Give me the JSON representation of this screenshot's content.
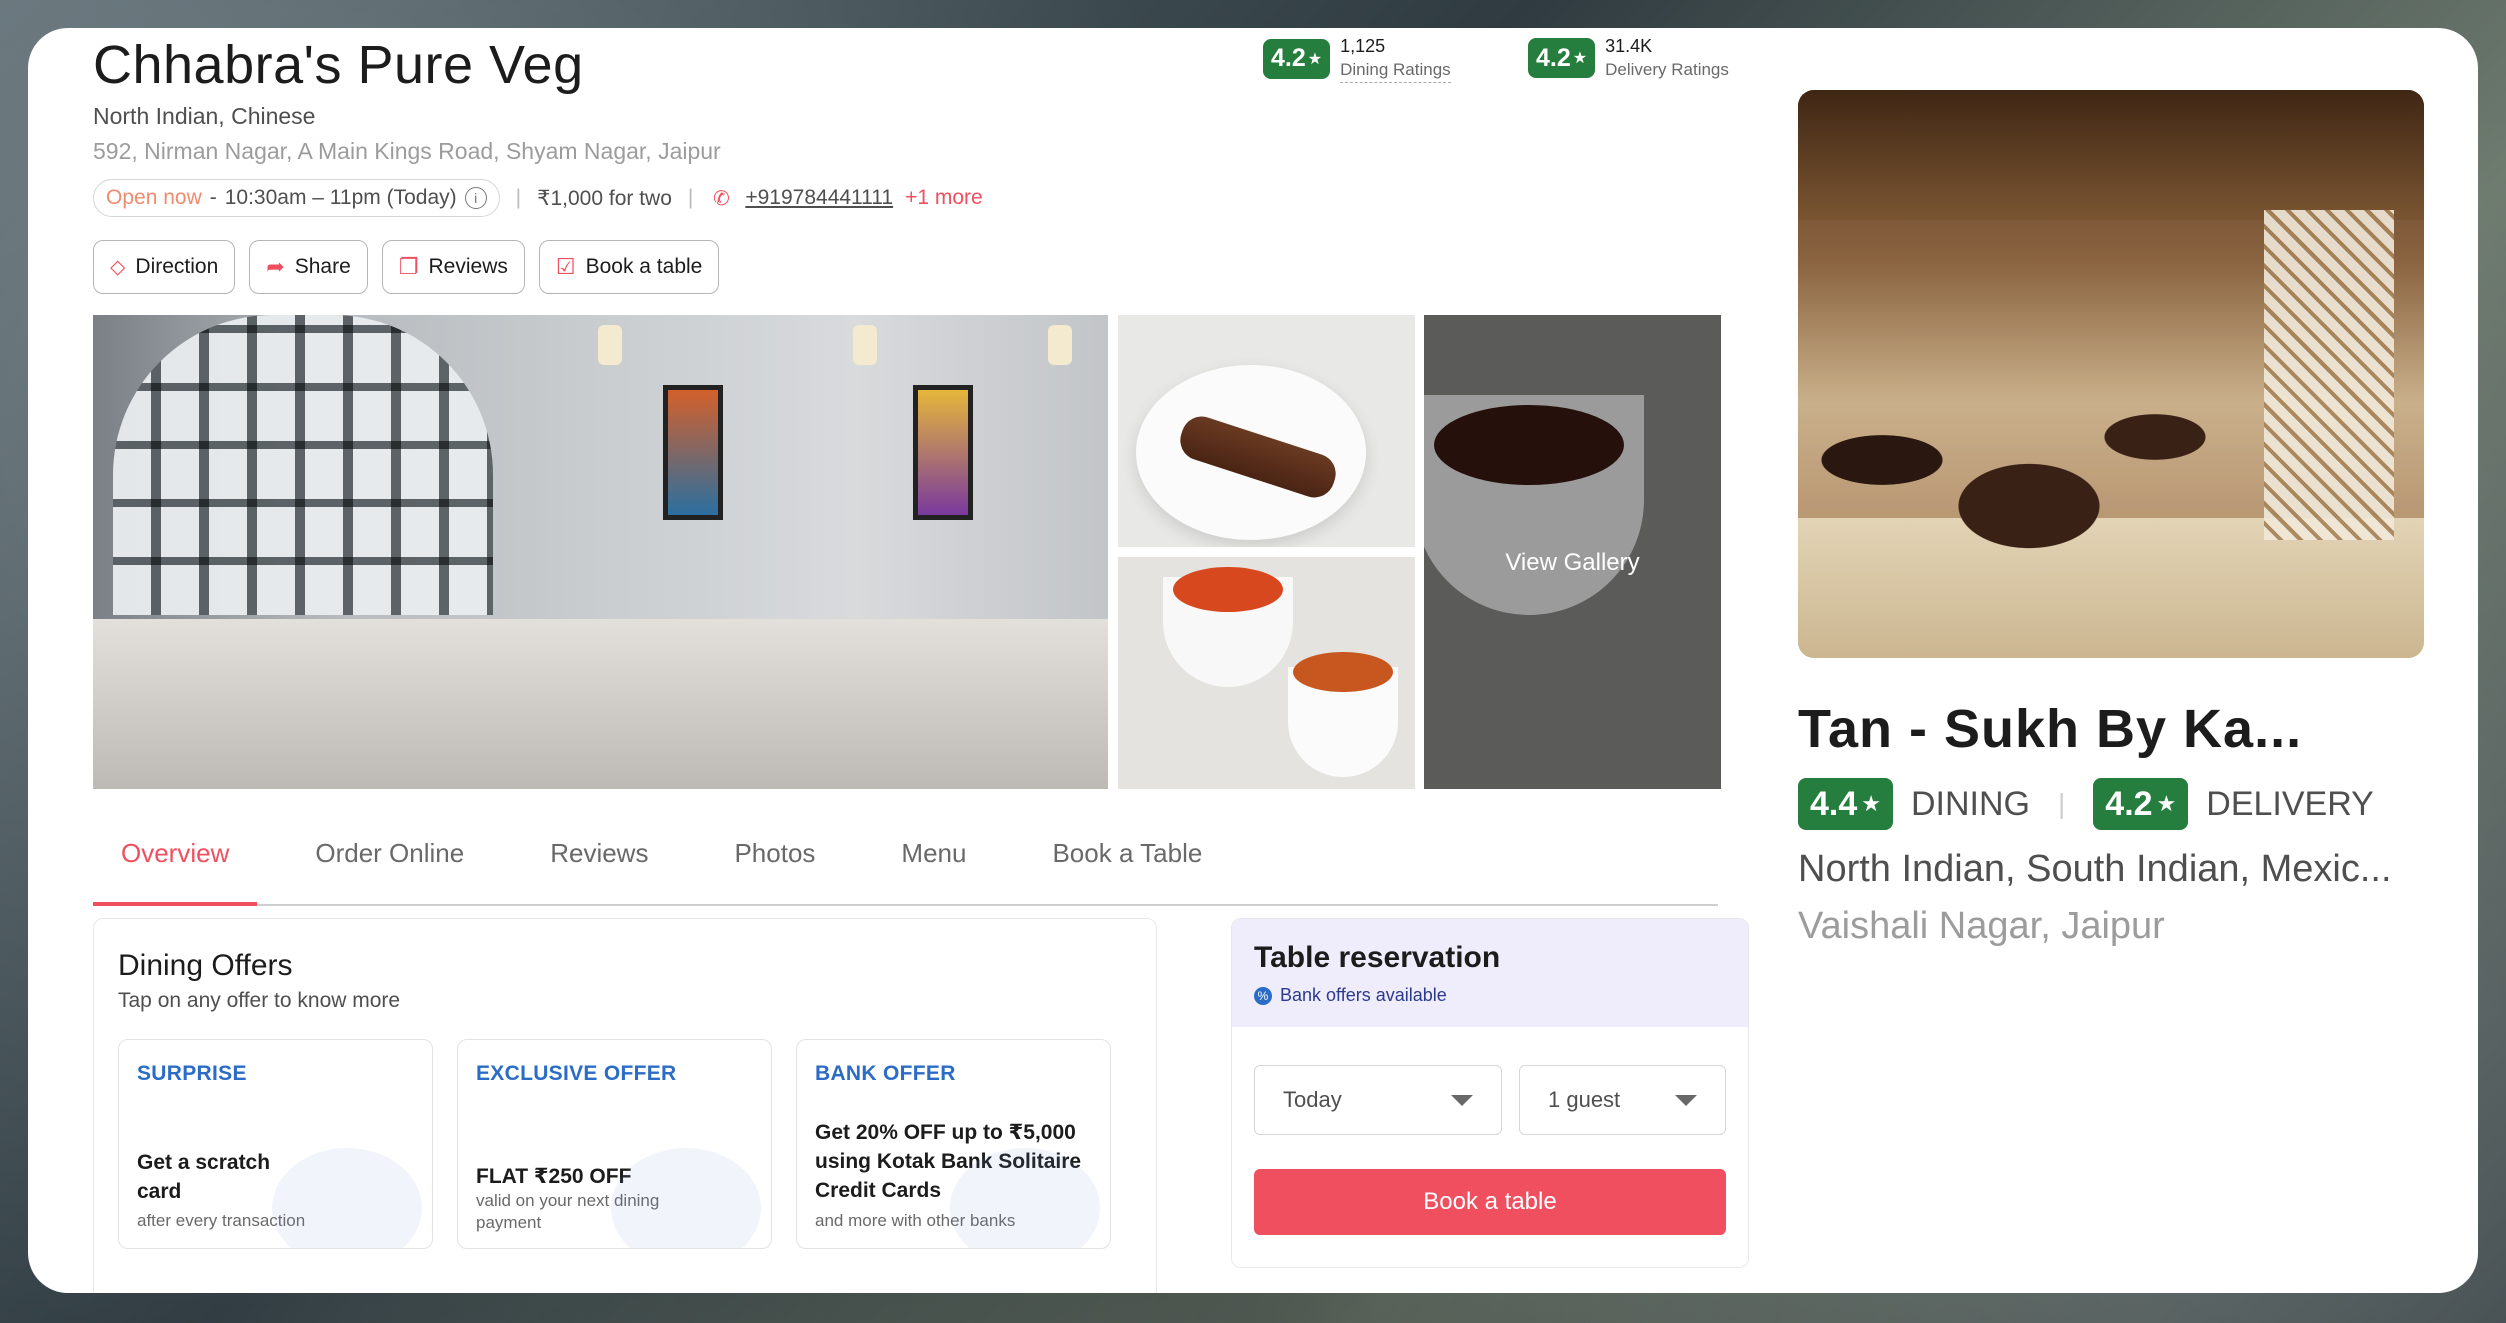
{
  "restaurant": {
    "name": "Chhabra's Pure Veg",
    "cuisines": "North Indian, Chinese",
    "address": "592, Nirman Nagar, A Main Kings Road, Shyam Nagar, Jaipur",
    "open_status": "Open now",
    "hours": "10:30am – 11pm (Today)",
    "cost_for_two": "₹1,000 for two",
    "phone": "+919784441111",
    "phone_more": "+1 more"
  },
  "ratings": {
    "dining": {
      "value": "4.2",
      "count": "1,125",
      "label": "Dining Ratings"
    },
    "delivery": {
      "value": "4.2",
      "count": "31.4K",
      "label": "Delivery Ratings"
    }
  },
  "actions": [
    {
      "label": "Direction",
      "icon": "direction-icon"
    },
    {
      "label": "Share",
      "icon": "share-icon"
    },
    {
      "label": "Reviews",
      "icon": "reviews-icon"
    },
    {
      "label": "Book a table",
      "icon": "calendar-icon"
    }
  ],
  "gallery": {
    "view_label": "View Gallery"
  },
  "tabs": [
    "Overview",
    "Order Online",
    "Reviews",
    "Photos",
    "Menu",
    "Book a Table"
  ],
  "active_tab": "Overview",
  "offers": {
    "heading": "Dining Offers",
    "subheading": "Tap on any offer to know more",
    "cards": [
      {
        "tag": "SURPRISE",
        "title": "Get a scratch card",
        "detail": "after every transaction"
      },
      {
        "tag": "EXCLUSIVE OFFER",
        "title": "FLAT ₹250 OFF",
        "detail": "valid on your next dining payment"
      },
      {
        "tag": "BANK OFFER",
        "title": "Get 20% OFF up to ₹5,000 using Kotak Bank Solitaire Credit Cards",
        "detail": "and more with other banks"
      }
    ]
  },
  "reservation": {
    "title": "Table reservation",
    "bank_note": "Bank offers available",
    "date_value": "Today",
    "guests_value": "1 guest",
    "button_label": "Book a table"
  },
  "suggested": {
    "name": "Tan - Sukh By Ka...",
    "dining_rating": "4.4",
    "dining_label": "DINING",
    "delivery_rating": "4.2",
    "delivery_label": "DELIVERY",
    "cuisines": "North Indian, South Indian, Mexic...",
    "location": "Vaishali Nagar, Jaipur"
  },
  "colors": {
    "accent": "#ef4f5f",
    "rating_green": "#267e3e",
    "offer_blue": "#2b6cc6",
    "reservation_bg": "#efedfb"
  }
}
